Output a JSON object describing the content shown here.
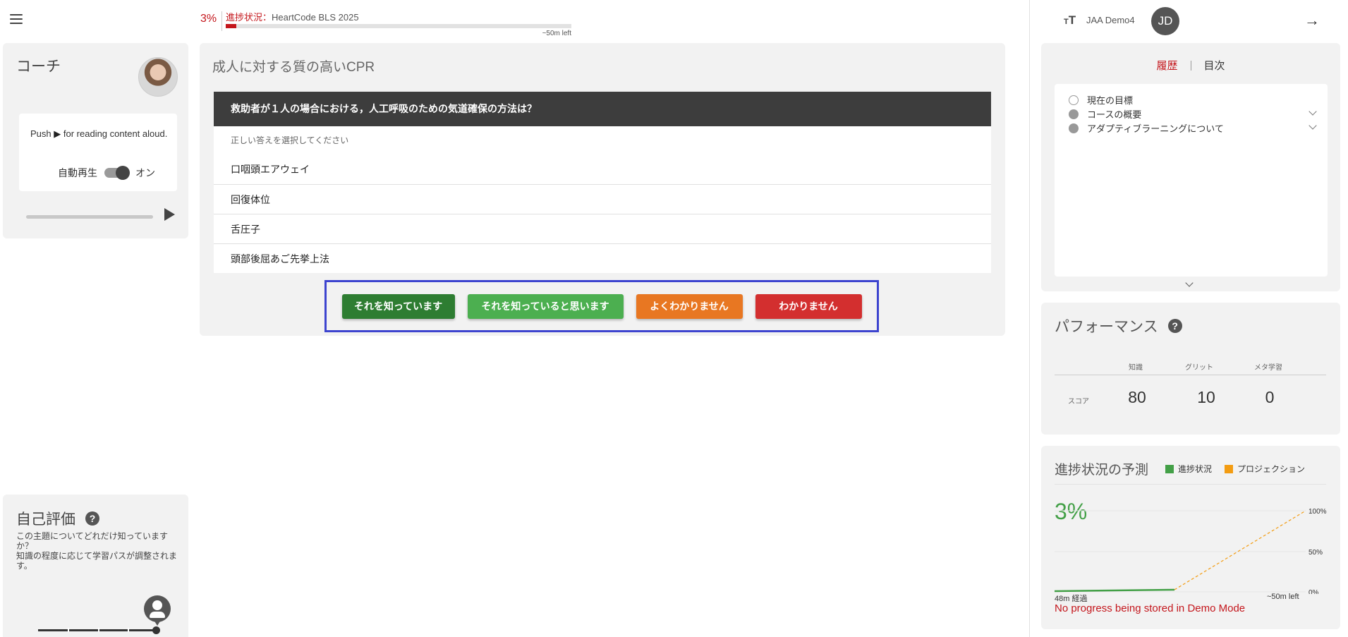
{
  "header": {
    "progress_pct": "3%",
    "progress_label": "進捗状況：",
    "course_name": "HeartCode BLS 2025",
    "progress_fraction": 0.03,
    "time_left": "~50m left"
  },
  "coach": {
    "title": "コーチ",
    "tts_text": "for reading content aloud.",
    "tts_push": "Push",
    "autoplay_label": "自動再生",
    "autoplay_state": "オン"
  },
  "self_eval": {
    "title": "自己評価",
    "description": "この主題についてどれだけ知っていますか？\n知識の程度に応じて学習パスが調整されます。"
  },
  "main": {
    "title": "成人に対する質の高いCPR",
    "question": "救助者が１人の場合における，人工呼吸のための気道確保の方法は？",
    "hint": "正しい答えを選択してください",
    "answers": [
      "口咽頭エアウェイ",
      "回復体位",
      "舌圧子",
      "頭部後屈あご先挙上法"
    ],
    "rating_buttons": {
      "know": "それを知っています",
      "think": "それを知っていると思います",
      "unsure": "よくわかりません",
      "dontknow": "わかりません"
    }
  },
  "right_panel": {
    "user_name": "JAA Demo4",
    "user_initials": "JD",
    "history": {
      "tab_history": "履歴",
      "tab_toc": "目次",
      "items": [
        "現在の目標",
        "コースの概要",
        "アダプティブラーニングについて"
      ]
    },
    "performance": {
      "title": "パフォーマンス",
      "headers": [
        "知識",
        "グリット",
        "メタ学習"
      ],
      "row_label": "スコア",
      "values": [
        "80",
        "10",
        "0"
      ]
    },
    "prediction": {
      "title": "進捗状況の予測",
      "legend_progress": "進捗状況",
      "legend_projection": "プロジェクション",
      "current_pct": "3%",
      "elapsed": "48m 経過",
      "left": "~50m left",
      "warning": "No progress being stored in Demo Mode",
      "ticks": [
        "100%",
        "50%",
        "0%"
      ]
    }
  },
  "colors": {
    "brand_red": "#c4161c",
    "progress_green": "#43a047",
    "projection_orange": "#f39c12",
    "highlight_blue": "#3d44cf"
  },
  "icons": {
    "menu": "hamburger-icon",
    "play": "play-icon",
    "help": "help-icon",
    "font_size": "text-size-icon",
    "exit": "arrow-right-icon"
  }
}
